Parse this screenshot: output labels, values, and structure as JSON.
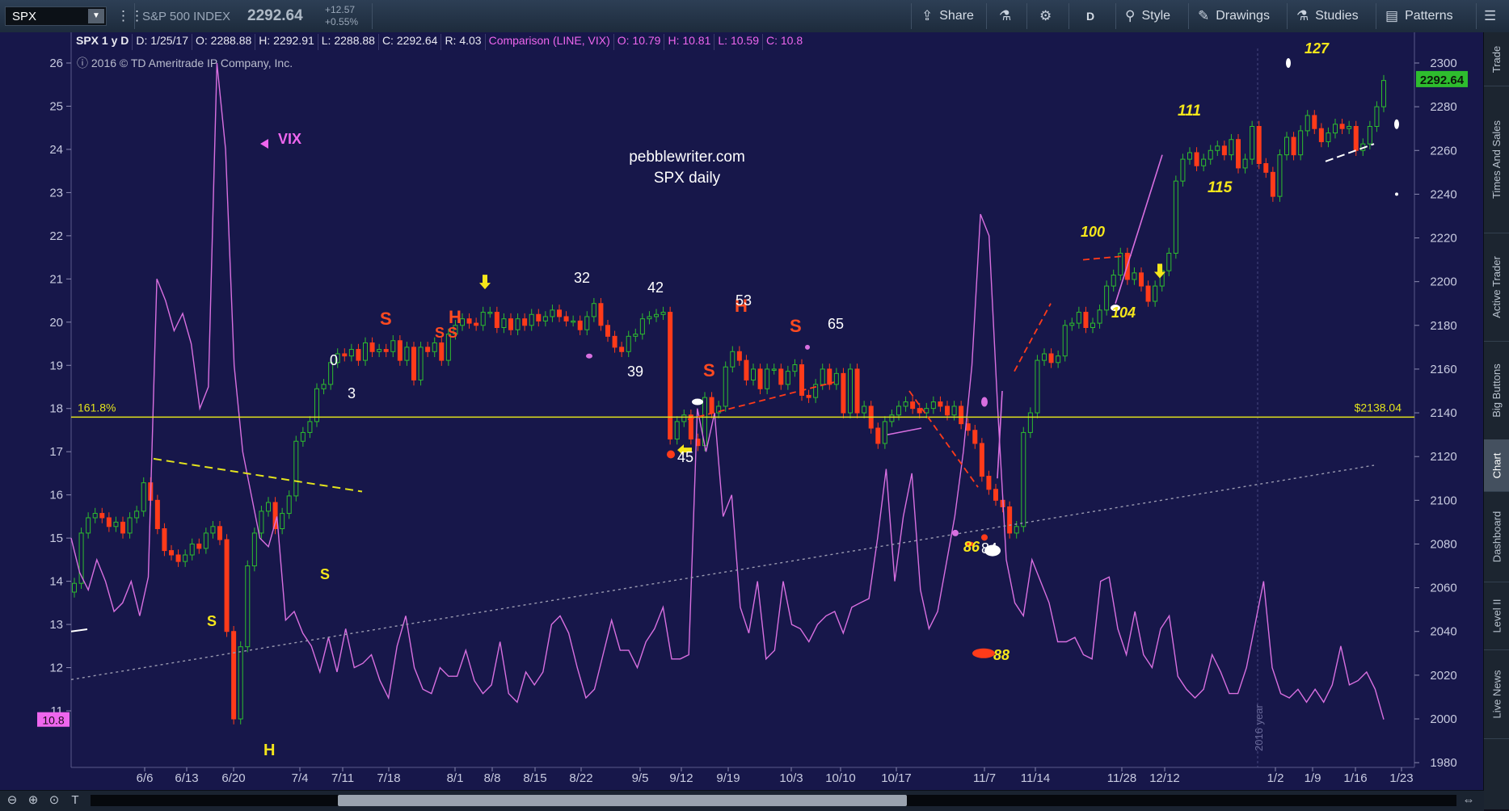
{
  "toolbar": {
    "symbol": "SPX",
    "name": "S&P 500 INDEX",
    "last": "2292.64",
    "change": "+12.57",
    "change_pct": "+0.55%",
    "share": "Share",
    "timeframe": "D",
    "style": "Style",
    "drawings": "Drawings",
    "studies": "Studies",
    "patterns": "Patterns"
  },
  "infobar": {
    "title": "SPX 1 y D",
    "date": "D: 1/25/17",
    "open": "O: 2288.88",
    "high": "H: 2292.91",
    "low": "L: 2288.88",
    "close": "C: 2292.64",
    "range": "R: 4.03",
    "comparison": "Comparison (LINE, VIX)",
    "cmp_open": "O: 10.79",
    "cmp_high": "H: 10.81",
    "cmp_low": "L: 10.59",
    "cmp_close": "C: 10.8"
  },
  "copyright": "ⓘ 2016 © TD Ameritrade IP Company, Inc.",
  "rail": [
    "Trade",
    "Times And Sales",
    "Active Trader",
    "Big Buttons",
    "Chart",
    "Dashboard",
    "Level II",
    "Live News"
  ],
  "colors": {
    "background": "#17174a",
    "up_candle": "#2ebd2e",
    "down_candle": "#ff3b1a",
    "vix_line": "#d86fe0",
    "fib_line": "#e3e31d",
    "label_yellow": "#f5e61b",
    "label_red": "#ff4a20",
    "label_white": "#ffffff"
  },
  "chart_data": {
    "type": "line",
    "title": "",
    "watermark": [
      "pebblewriter.com",
      "SPX daily"
    ],
    "x_ticks": [
      "6/6",
      "6/13",
      "6/20",
      "7/4",
      "7/11",
      "7/18",
      "8/1",
      "8/8",
      "8/15",
      "8/22",
      "9/5",
      "9/12",
      "9/19",
      "10/3",
      "10/10",
      "10/17",
      "11/7",
      "11/14",
      "11/28",
      "12/12",
      "1/2",
      "1/9",
      "1/16",
      "1/23"
    ],
    "y_right": {
      "ylim": [
        1980,
        2300
      ],
      "ticks": [
        1980,
        2000,
        2020,
        2040,
        2060,
        2080,
        2100,
        2120,
        2140,
        2160,
        2180,
        2200,
        2220,
        2240,
        2260,
        2280,
        2300
      ]
    },
    "y_left": {
      "ylim": [
        10.5,
        26
      ],
      "ticks": [
        11,
        12,
        13,
        14,
        15,
        16,
        17,
        18,
        19,
        20,
        21,
        22,
        23,
        24,
        25,
        26
      ]
    },
    "last_price_label": "2292.64",
    "last_vix_label": "10.8",
    "fib_level": {
      "label": "161.8%",
      "price_label": "$2138.04",
      "value": 2138.04
    },
    "year_marker": "2016 year",
    "series": [
      {
        "name": "VIX",
        "values": [
          15.0,
          14.2,
          13.8,
          14.5,
          14.0,
          13.3,
          13.5,
          14.0,
          13.2,
          14.1,
          21.0,
          20.5,
          19.8,
          20.2,
          19.5,
          18.0,
          18.5,
          26.0,
          24.0,
          19.0,
          17.0,
          16.0,
          15.0,
          14.8,
          15.5,
          13.1,
          13.3,
          12.8,
          12.5,
          11.9,
          12.7,
          11.9,
          12.9,
          12.0,
          12.1,
          12.3,
          11.7,
          11.3,
          12.5,
          13.2,
          12.0,
          11.5,
          11.4,
          12.0,
          11.8,
          11.8,
          12.4,
          11.7,
          11.4,
          11.6,
          12.6,
          11.4,
          11.2,
          11.9,
          11.6,
          11.9,
          13.0,
          13.2,
          12.8,
          12.0,
          11.3,
          11.5,
          12.3,
          13.1,
          12.4,
          12.4,
          12.0,
          12.6,
          12.9,
          13.4,
          12.2,
          12.2,
          12.3,
          18.0,
          17.0,
          17.9,
          15.5,
          16.0,
          13.4,
          12.8,
          14.0,
          12.2,
          12.4,
          14.0,
          13.0,
          12.9,
          12.6,
          13.0,
          13.2,
          13.3,
          12.8,
          13.4,
          13.5,
          13.6,
          15.0,
          16.6,
          14.0,
          15.5,
          16.5,
          13.8,
          12.9,
          13.3,
          14.4,
          15.5,
          17.0,
          19.0,
          22.5,
          22.0,
          18.0,
          14.5,
          13.5,
          13.2,
          14.5,
          14.0,
          13.5,
          12.6,
          12.6,
          12.7,
          12.3,
          12.2,
          14.0,
          14.1,
          12.9,
          12.3,
          13.3,
          12.3,
          12.0,
          12.9,
          13.2,
          11.8,
          11.5,
          11.3,
          11.5,
          12.3,
          11.9,
          11.4,
          11.4,
          12.0,
          13.0,
          14.0,
          12.0,
          11.4,
          11.3,
          11.5,
          11.2,
          11.5,
          11.2,
          11.6,
          12.5,
          11.6,
          11.7,
          11.9,
          11.5,
          10.8
        ],
        "axis": "left"
      },
      {
        "name": "SPX",
        "type": "candlestick",
        "values": [
          2062,
          2085,
          2092,
          2094,
          2092,
          2088,
          2090,
          2085,
          2092,
          2095,
          2108,
          2100,
          2087,
          2077,
          2075,
          2072,
          2075,
          2080,
          2078,
          2085,
          2088,
          2082,
          2040,
          2000,
          2033,
          2070,
          2085,
          2095,
          2099,
          2087,
          2094,
          2102,
          2127,
          2131,
          2136,
          2151,
          2153,
          2163,
          2167,
          2166,
          2169,
          2164,
          2172,
          2168,
          2169,
          2168,
          2173,
          2164,
          2170,
          2155,
          2170,
          2168,
          2172,
          2164,
          2176,
          2180,
          2183,
          2181,
          2180,
          2186,
          2186,
          2179,
          2183,
          2178,
          2183,
          2180,
          2185,
          2182,
          2184,
          2187,
          2184,
          2182,
          2182,
          2178,
          2184,
          2190,
          2180,
          2175,
          2170,
          2168,
          2175,
          2176,
          2183,
          2184,
          2185,
          2186,
          2128,
          2136,
          2139,
          2128,
          2125,
          2147,
          2140,
          2143,
          2161,
          2168,
          2164,
          2155,
          2160,
          2151,
          2160,
          2160,
          2153,
          2159,
          2162,
          2148,
          2147,
          2153,
          2160,
          2153,
          2158,
          2140,
          2160,
          2140,
          2143,
          2133,
          2126,
          2136,
          2139,
          2143,
          2145,
          2142,
          2140,
          2142,
          2145,
          2143,
          2139,
          2143,
          2135,
          2132,
          2126,
          2111,
          2105,
          2100,
          2097,
          2085,
          2088,
          2131,
          2140,
          2164,
          2167,
          2163,
          2166,
          2180,
          2181,
          2186,
          2179,
          2181,
          2187,
          2198,
          2203,
          2213,
          2201,
          2204,
          2198,
          2191,
          2198,
          2205,
          2213,
          2246,
          2256,
          2259,
          2253,
          2256,
          2260,
          2262,
          2258,
          2265,
          2252,
          2256,
          2271,
          2254,
          2250,
          2239,
          2258,
          2266,
          2258,
          2269,
          2276,
          2270,
          2264,
          2268,
          2272,
          2270,
          2271,
          2260,
          2263,
          2271,
          2280,
          2292
        ],
        "axis": "right"
      }
    ],
    "annotations": [
      {
        "text": "VIX",
        "color": "#ee66ee"
      },
      {
        "text": "S",
        "color": "#f5e61b"
      },
      {
        "text": "H",
        "color": "#f5e61b"
      },
      {
        "text": "S",
        "color": "#f5e61b"
      },
      {
        "text": "S",
        "color": "#ff4a20"
      },
      {
        "text": "H",
        "color": "#ff4a20"
      },
      {
        "text": "S",
        "color": "#ff4a20"
      },
      {
        "text": "S",
        "color": "#ff4a20"
      },
      {
        "text": "H",
        "color": "#ff4a20"
      },
      {
        "text": "S",
        "color": "#ff4a20"
      },
      {
        "text": "S",
        "color": "#ff4a20"
      },
      {
        "text": "0",
        "color": "#ffffff"
      },
      {
        "text": "3",
        "color": "#ffffff"
      },
      {
        "text": "32",
        "color": "#ffffff"
      },
      {
        "text": "39",
        "color": "#ffffff"
      },
      {
        "text": "42",
        "color": "#ffffff"
      },
      {
        "text": "45",
        "color": "#ffffff"
      },
      {
        "text": "53",
        "color": "#ffffff"
      },
      {
        "text": "65",
        "color": "#ffffff"
      },
      {
        "text": "84",
        "color": "#ffffff"
      },
      {
        "text": "86",
        "color": "#f5e61b"
      },
      {
        "text": "88",
        "color": "#f5e61b"
      },
      {
        "text": "100",
        "color": "#f5e61b"
      },
      {
        "text": "104",
        "color": "#f5e61b"
      },
      {
        "text": "111",
        "color": "#f5e61b"
      },
      {
        "text": "115",
        "color": "#f5e61b"
      },
      {
        "text": "127",
        "color": "#f5e61b"
      }
    ]
  }
}
